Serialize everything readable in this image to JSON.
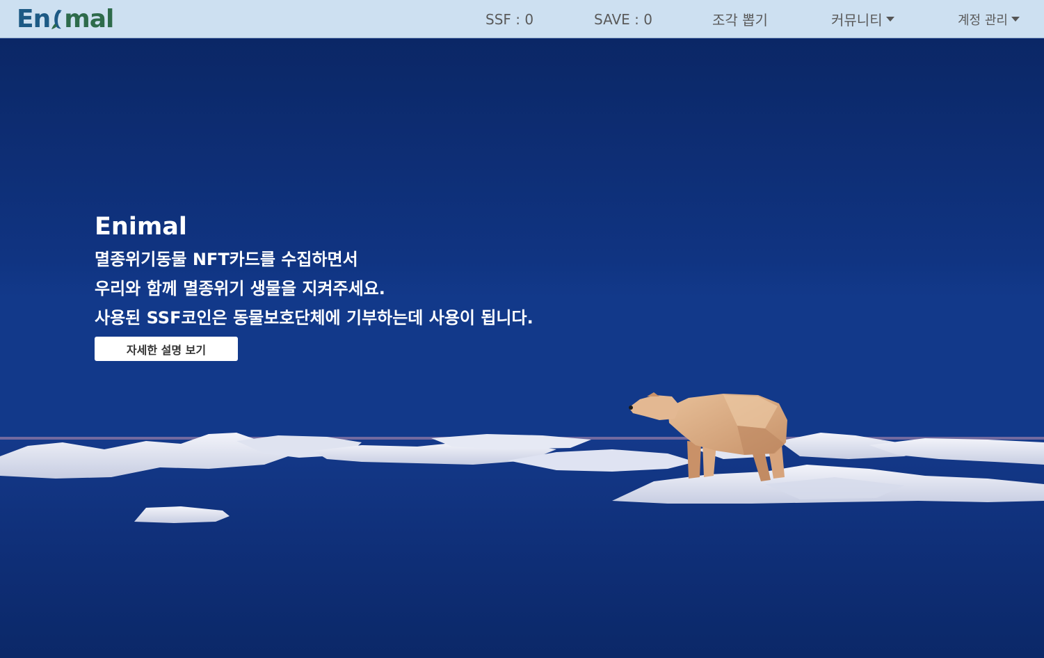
{
  "app": {
    "logo_left": "En",
    "logo_right": "mal"
  },
  "nav": {
    "ssf_label": "SSF : 0",
    "save_label": "SAVE : 0",
    "gacha_label": "조각 뽑기",
    "community_label": "커뮤니티",
    "account_label": "계정 관리"
  },
  "hero": {
    "title": "Enimal",
    "lines": [
      "멸종위기동물 NFT카드를 수집하면서",
      "우리와 함께 멸종위기 생물을 지켜주세요.",
      "사용된 SSF코인은 동물보호단체에 기부하는데 사용이 됩니다."
    ],
    "button_label": "자세한 설명 보기"
  },
  "colors": {
    "navbar_bg": "#cde0f1",
    "hero_bg": "#0e2f7a",
    "logo_blue": "#1d5a85",
    "logo_green": "#2e6b4b"
  }
}
